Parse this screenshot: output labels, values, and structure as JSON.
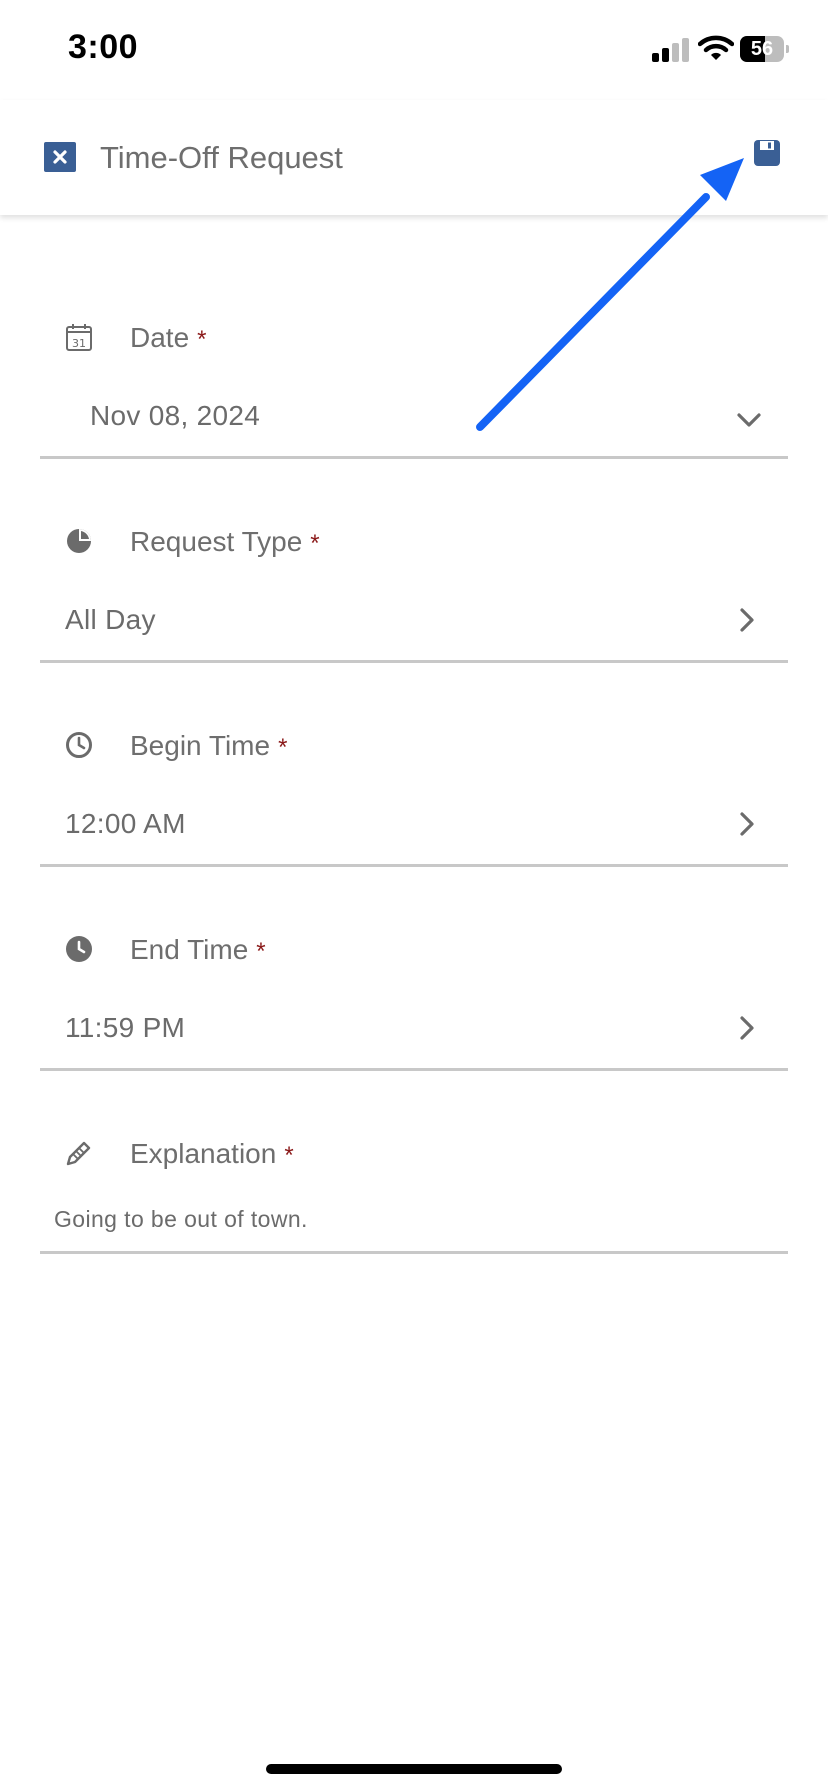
{
  "status_bar": {
    "time": "3:00",
    "battery_level": "56",
    "battery_fraction": 0.56
  },
  "header": {
    "title": "Time-Off Request",
    "close_icon": "close-icon",
    "save_icon": "save-icon",
    "accent_color": "#3a5f95"
  },
  "form": {
    "required_marker": "*",
    "required_color": "#8b1a1a",
    "fields": [
      {
        "label": "Date",
        "value": "Nov 08, 2024",
        "icon": "calendar-icon",
        "control": "chevron-down-icon"
      },
      {
        "label": "Request Type",
        "value": "All Day",
        "icon": "pie-chart-icon",
        "control": "chevron-right-icon"
      },
      {
        "label": "Begin Time",
        "value": "12:00 AM",
        "icon": "clock-outline-icon",
        "control": "chevron-right-icon"
      },
      {
        "label": "End Time",
        "value": "11:59 PM",
        "icon": "clock-filled-icon",
        "control": "chevron-right-icon"
      },
      {
        "label": "Explanation",
        "value": "Going to be out of town.",
        "icon": "pencil-icon"
      }
    ]
  },
  "annotation": {
    "color": "#1463f5"
  }
}
